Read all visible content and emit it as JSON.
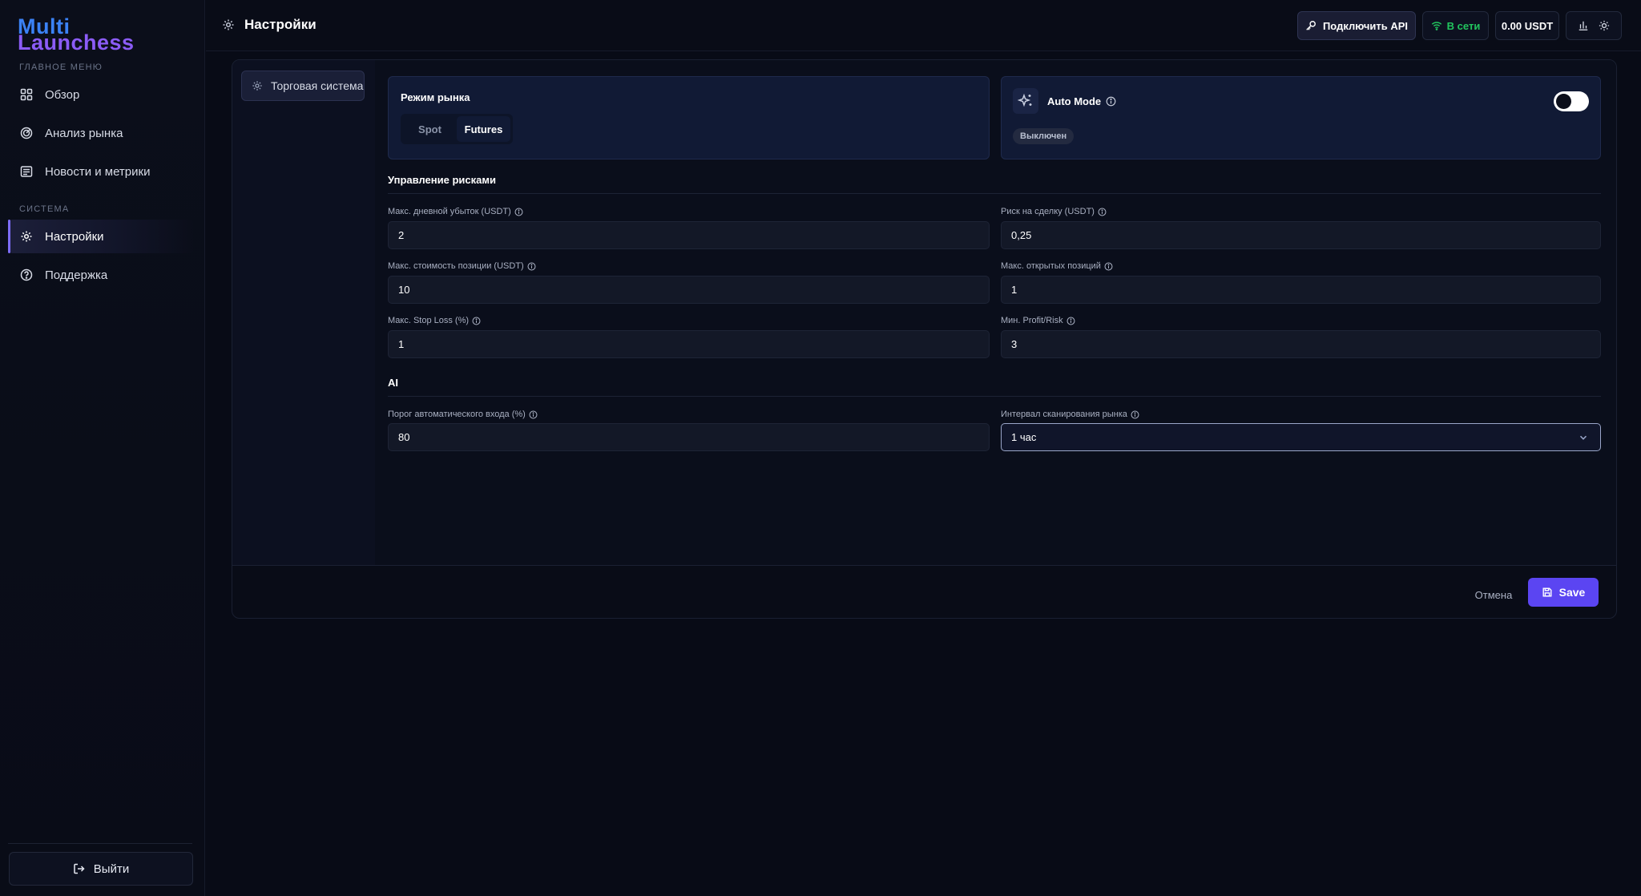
{
  "brand": {
    "line1": "Multi",
    "line2": "Launchess"
  },
  "sidebar": {
    "main_section": "ГЛАВНОЕ МЕНЮ",
    "system_section": "СИСТЕМА",
    "items": [
      {
        "label": "Обзор",
        "icon": "grid-icon"
      },
      {
        "label": "Анализ рынка",
        "icon": "radar-icon"
      },
      {
        "label": "Новости и метрики",
        "icon": "newspaper-icon"
      },
      {
        "label": "Настройки",
        "icon": "gear-icon"
      },
      {
        "label": "Поддержка",
        "icon": "help-circle-icon"
      }
    ],
    "logout_label": "Выйти"
  },
  "header": {
    "title": "Настройки",
    "api_label": "Подключить API",
    "online_label": "В сети",
    "balance": "0.00 USDT"
  },
  "settings": {
    "tab_label": "Торговая система",
    "market_mode": {
      "title": "Режим рынка",
      "options": [
        "Spot",
        "Futures"
      ],
      "selected": "Futures"
    },
    "auto_mode": {
      "title": "Auto Mode",
      "status": "Выключен",
      "enabled": false
    },
    "risk": {
      "title": "Управление рисками",
      "max_daily_loss_label": "Макс. дневной убыток (USDT)",
      "max_daily_loss": "2",
      "risk_per_trade_label": "Риск на сделку (USDT)",
      "risk_per_trade": "0,25",
      "max_position_cost_label": "Макс. стоимость позиции (USDT)",
      "max_position_cost": "10",
      "max_open_positions_label": "Макс. открытых позиций",
      "max_open_positions": "1",
      "max_stop_loss_label": "Макс. Stop Loss (%)",
      "max_stop_loss": "1",
      "min_profit_risk_label": "Мин. Profit/Risk",
      "min_profit_risk": "3"
    },
    "ai": {
      "title": "AI",
      "auto_entry_threshold_label": "Порог автоматического входа (%)",
      "auto_entry_threshold": "80",
      "scan_interval_label": "Интервал сканирования рынка",
      "scan_interval": "1 час"
    },
    "cancel_label": "Отмена",
    "save_label": "Save"
  },
  "colors": {
    "accent": "#5b45f2",
    "online": "#22c55e",
    "background": "#080b16"
  }
}
